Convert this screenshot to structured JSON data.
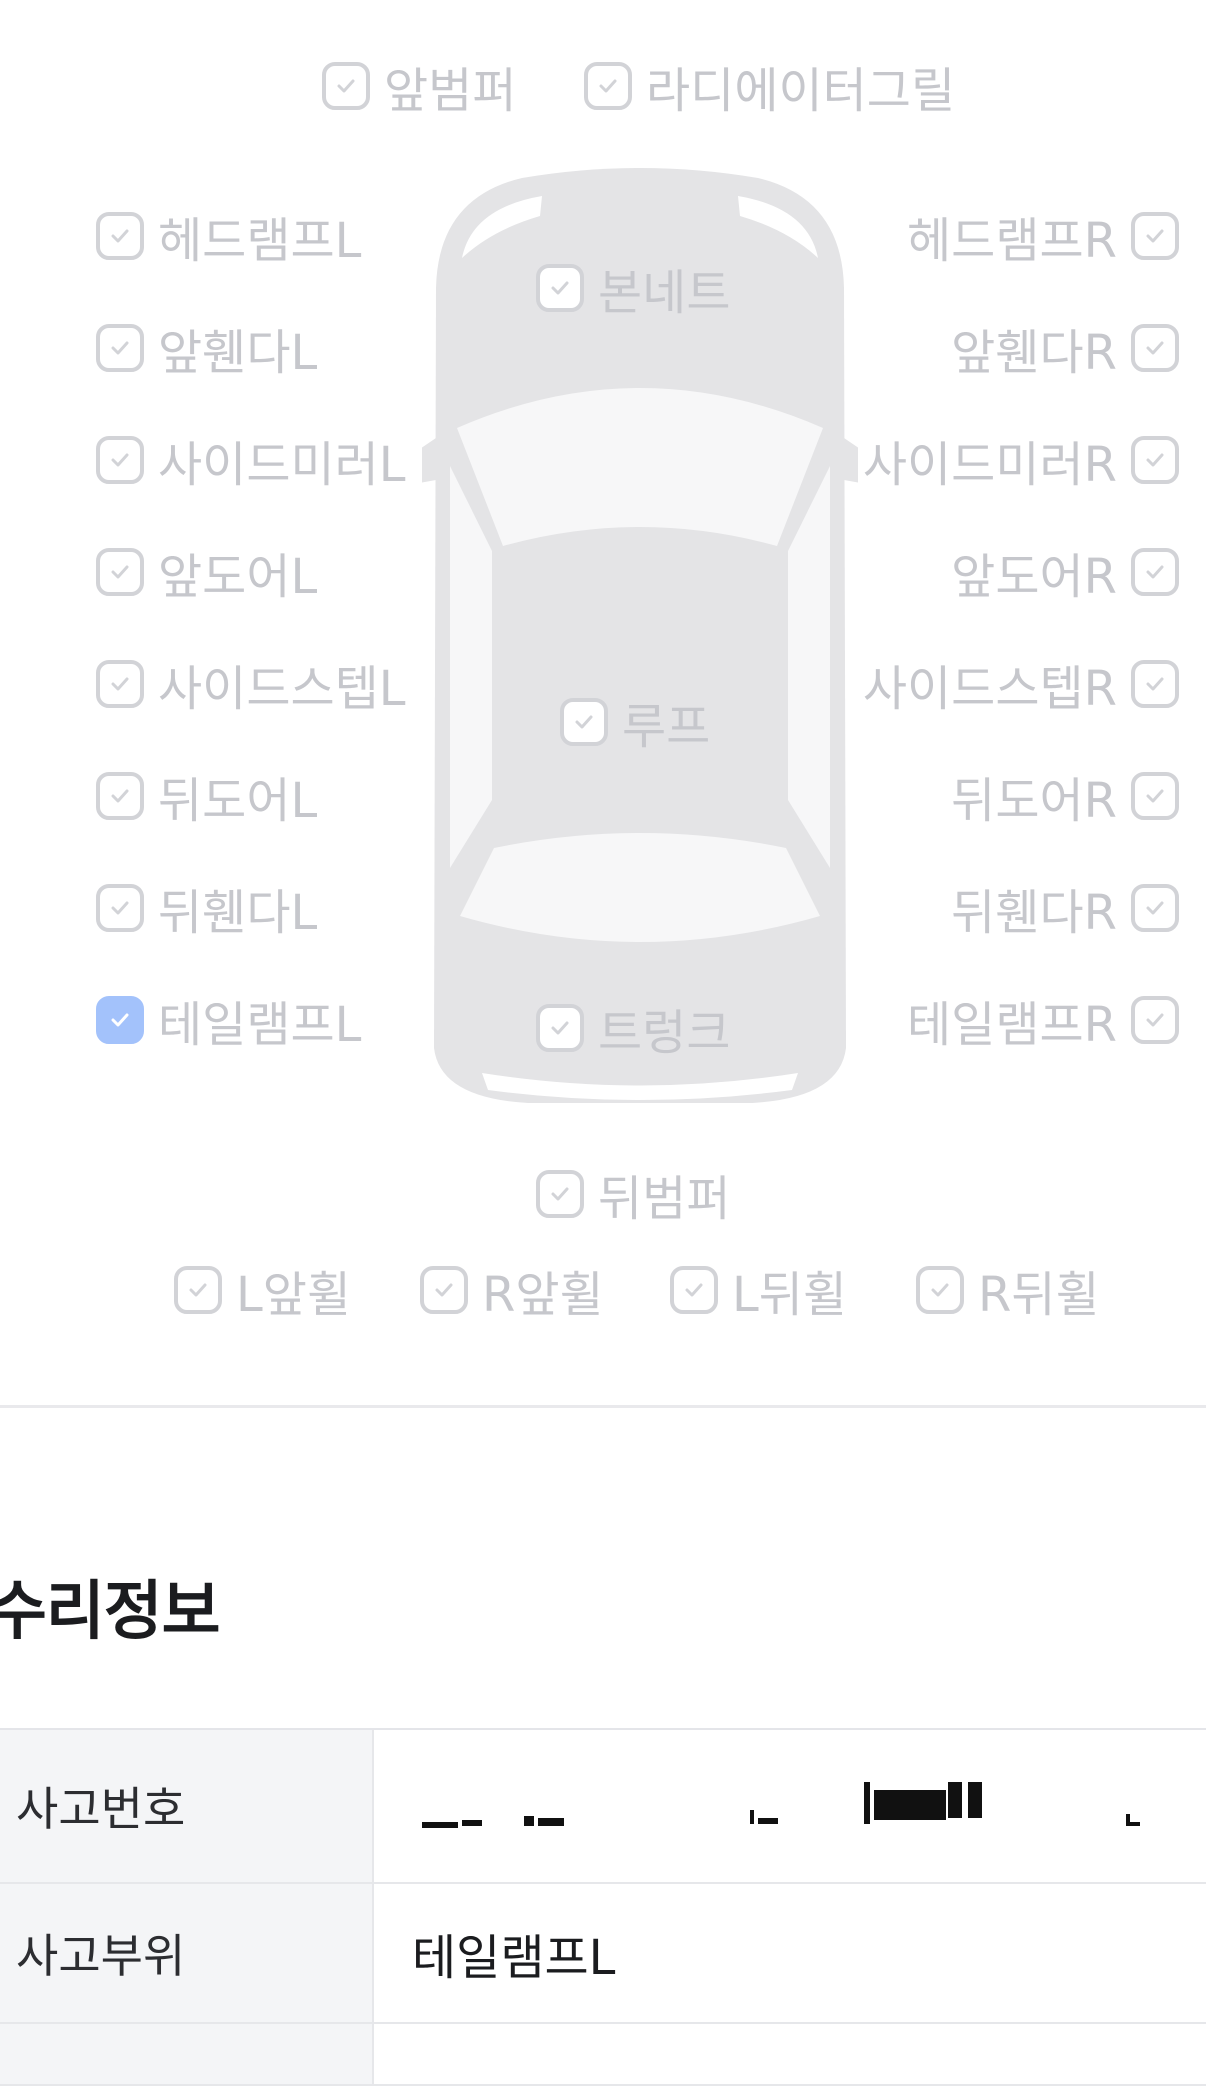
{
  "diagram": {
    "parts": {
      "front_bumper": "앞범퍼",
      "radiator_grille": "라디에이터그릴",
      "headlamp_l": "헤드램프L",
      "headlamp_r": "헤드램프R",
      "bonnet": "본네트",
      "front_fender_l": "앞휀다L",
      "front_fender_r": "앞휀다R",
      "side_mirror_l": "사이드미러L",
      "side_mirror_r": "사이드미러R",
      "front_door_l": "앞도어L",
      "front_door_r": "앞도어R",
      "side_step_l": "사이드스텝L",
      "side_step_r": "사이드스텝R",
      "roof": "루프",
      "rear_door_l": "뒤도어L",
      "rear_door_r": "뒤도어R",
      "rear_fender_l": "뒤휀다L",
      "rear_fender_r": "뒤휀다R",
      "tail_lamp_l": "테일램프L",
      "tail_lamp_r": "테일램프R",
      "trunk": "트렁크",
      "rear_bumper": "뒤범퍼",
      "l_front_wheel": "L앞휠",
      "r_front_wheel": "R앞휠",
      "l_rear_wheel": "L뒤휠",
      "r_rear_wheel": "R뒤휠"
    },
    "checked": [
      "tail_lamp_l"
    ],
    "colors": {
      "checked": "#a3c2fb",
      "unchecked": "#d2d3d7",
      "label": "#c6c7cc"
    }
  },
  "repair_info": {
    "title": "수리정보",
    "rows": [
      {
        "label": "사고번호",
        "value": ""
      },
      {
        "label": "사고부위",
        "value": "테일램프L"
      }
    ]
  }
}
